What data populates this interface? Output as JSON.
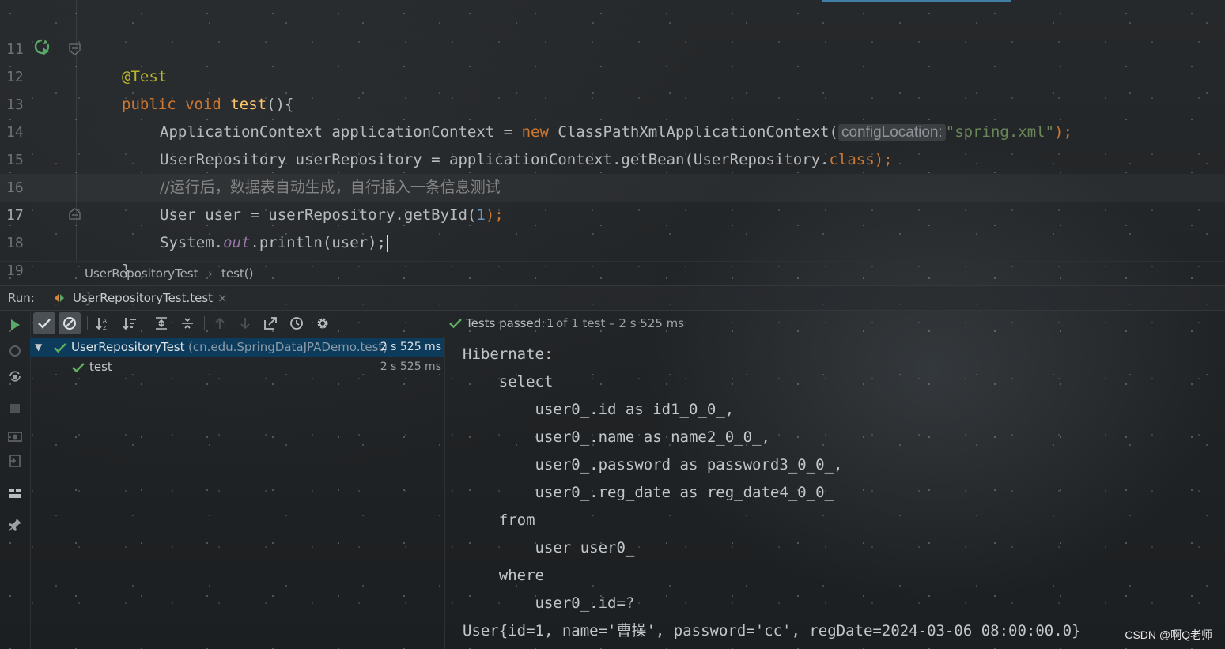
{
  "editor": {
    "lines": [
      {
        "num": "11",
        "annotation": "@Test"
      },
      {
        "num": "12",
        "kw1": "public",
        "kw2": "void",
        "method": "test",
        "rest": "(){"
      },
      {
        "num": "13",
        "type": "ApplicationContext applicationContext = ",
        "kw_new": "new",
        "cls": " ClassPathXmlApplicationContext(",
        "hint": "configLocation:",
        "str": "\"spring.xml\"",
        "end": ");"
      },
      {
        "num": "14",
        "pre": "UserRepository userRepository = applicationContext.getBean(UserRepository.",
        "kw_class": "class",
        "end": ");"
      },
      {
        "num": "15",
        "comment": "//运行后，数据表自动生成，自行插入一条信息测试"
      },
      {
        "num": "16",
        "pre": "User user = userRepository.getById(",
        "numval": "1",
        "end": ");"
      },
      {
        "num": "17",
        "pre": "System.",
        "field": "out",
        "post": ".println(user);"
      },
      {
        "num": "18",
        "text": "}"
      },
      {
        "num": "19",
        "text": "}"
      }
    ]
  },
  "breadcrumb": {
    "class_name": "UserRepositoryTest",
    "sep": "›",
    "method": "test()"
  },
  "run": {
    "label": "Run:",
    "tab": "UserRepositoryTest.test",
    "close": "×"
  },
  "status": {
    "prefix": "Tests passed:",
    "count": "1",
    "suffix": "of 1 test – 2 s 525 ms"
  },
  "tree": {
    "root": {
      "name": "UserRepositoryTest",
      "package": "(cn.edu.SpringDataJPADemo.test)",
      "duration": "2 s 525 ms"
    },
    "child": {
      "name": "test",
      "duration": "2 s 525 ms"
    }
  },
  "console": [
    "Hibernate: ",
    "    select",
    "        user0_.id as id1_0_0_,",
    "        user0_.name as name2_0_0_,",
    "        user0_.password as password3_0_0_,",
    "        user0_.reg_date as reg_date4_0_0_ ",
    "    from",
    "        user user0_ ",
    "    where",
    "        user0_.id=?",
    "User{id=1, name='曹操', password='cc', regDate=2024-03-06 08:00:00.0}"
  ],
  "watermark": "CSDN @啊Q老师",
  "colors": {
    "accent": "#3f7fa8",
    "pass_green": "#5fb05f",
    "selection": "#0d3b5c"
  },
  "icons": [
    "run-gutter-icon",
    "rerun-icon",
    "show-passed-icon",
    "show-ignored-icon",
    "sort-alpha-icon",
    "sort-duration-icon",
    "expand-all-icon",
    "collapse-all-icon",
    "prev-failed-icon",
    "next-failed-icon",
    "export-icon",
    "history-icon",
    "settings-icon",
    "stop-icon",
    "camera-icon",
    "exit-icon",
    "layout-icon",
    "pin-icon",
    "check-icon"
  ]
}
